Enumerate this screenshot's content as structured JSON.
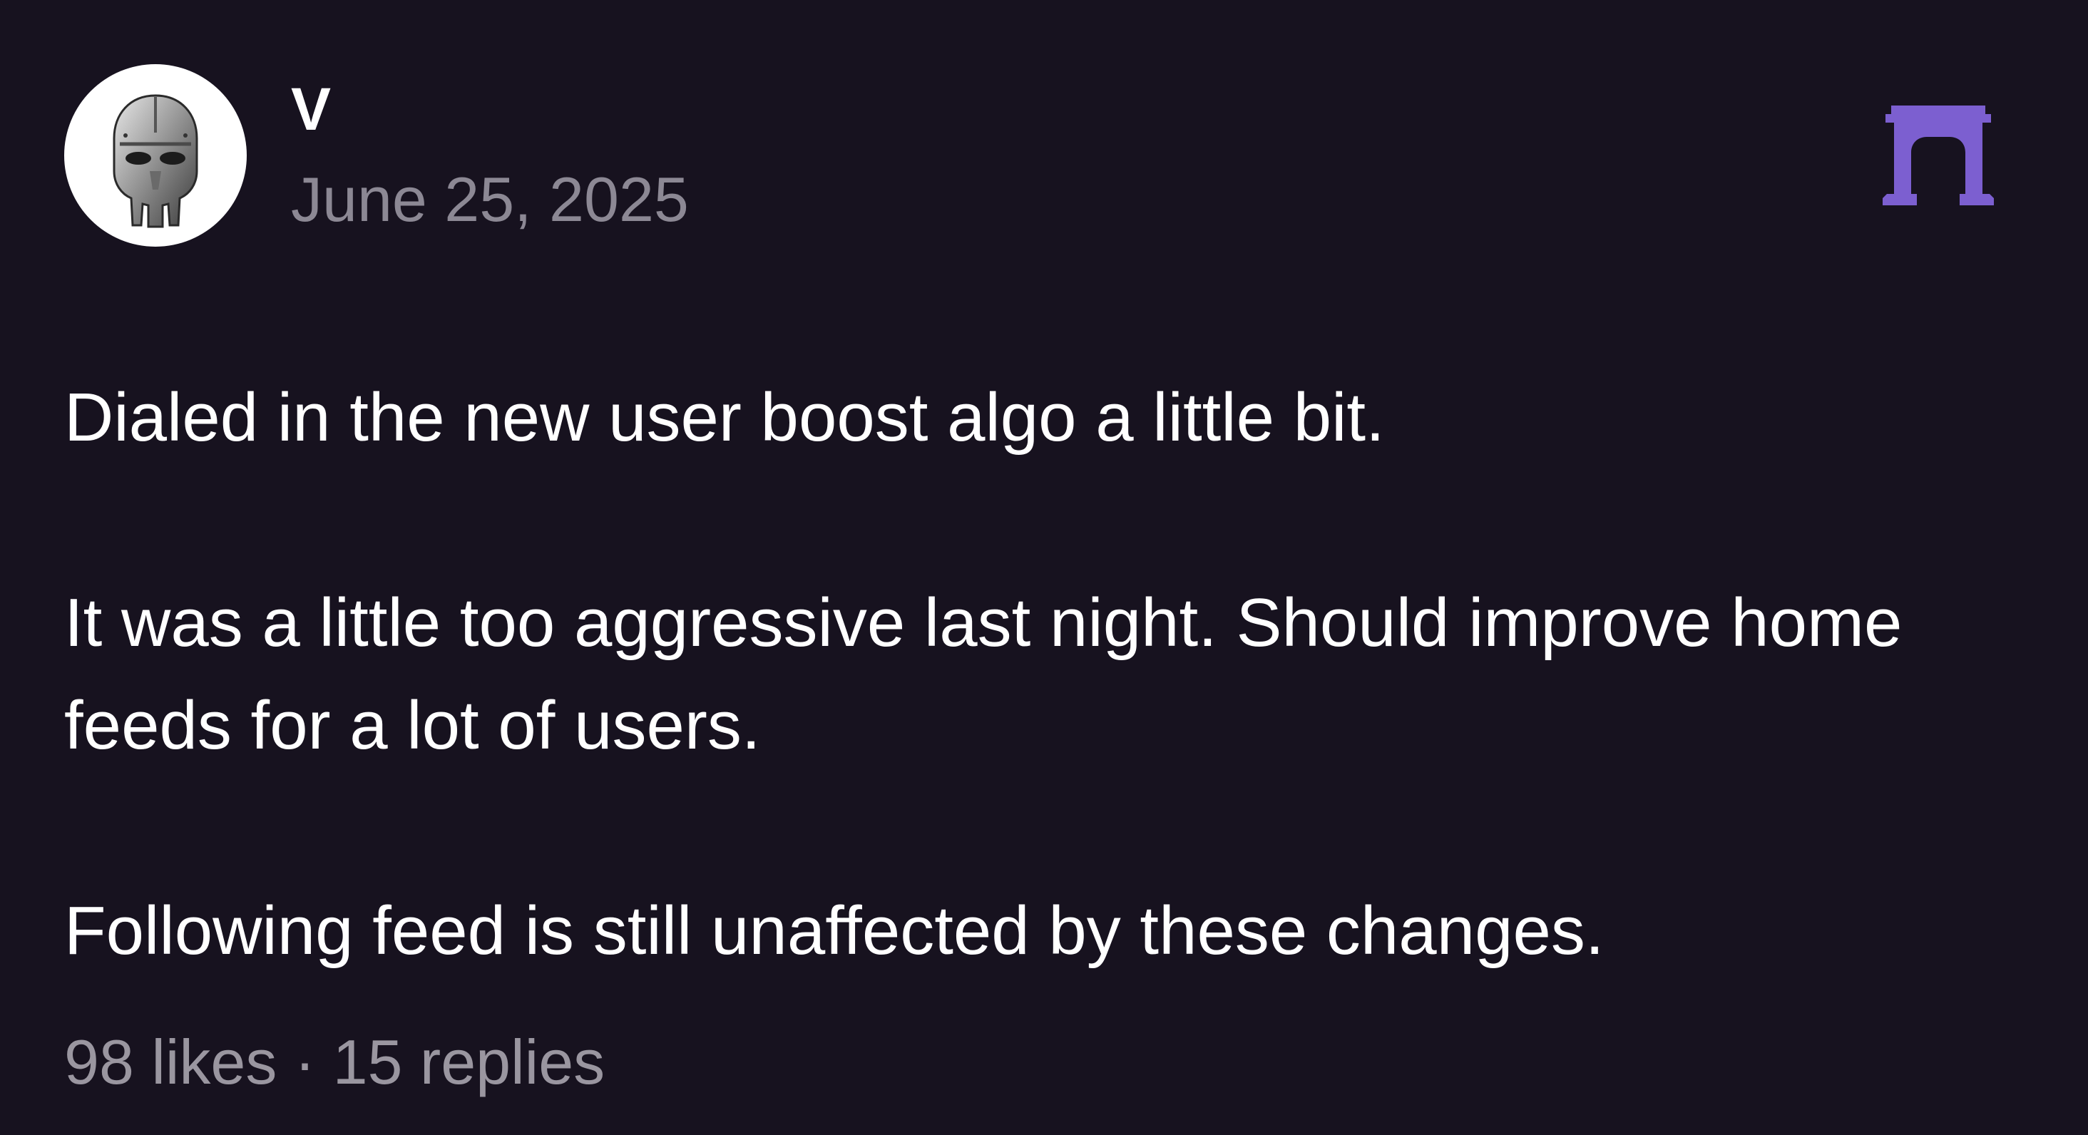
{
  "post": {
    "author": {
      "name": "V",
      "avatar_icon": "metal-mask-icon"
    },
    "date": "June 25, 2025",
    "brand_icon": "arch-gate-icon",
    "brand_color": "#7c5fd0",
    "paragraphs": [
      "Dialed in the new user boost algo a little bit.",
      "It was a little too aggressive last night. Should improve home feeds for a lot of users.",
      "Following feed is still unaffected by these changes."
    ],
    "stats": {
      "likes": "98 likes",
      "separator": "·",
      "replies": "15 replies"
    }
  },
  "colors": {
    "background": "#17121f",
    "text_primary": "#ffffff",
    "text_secondary": "#8c8894"
  }
}
